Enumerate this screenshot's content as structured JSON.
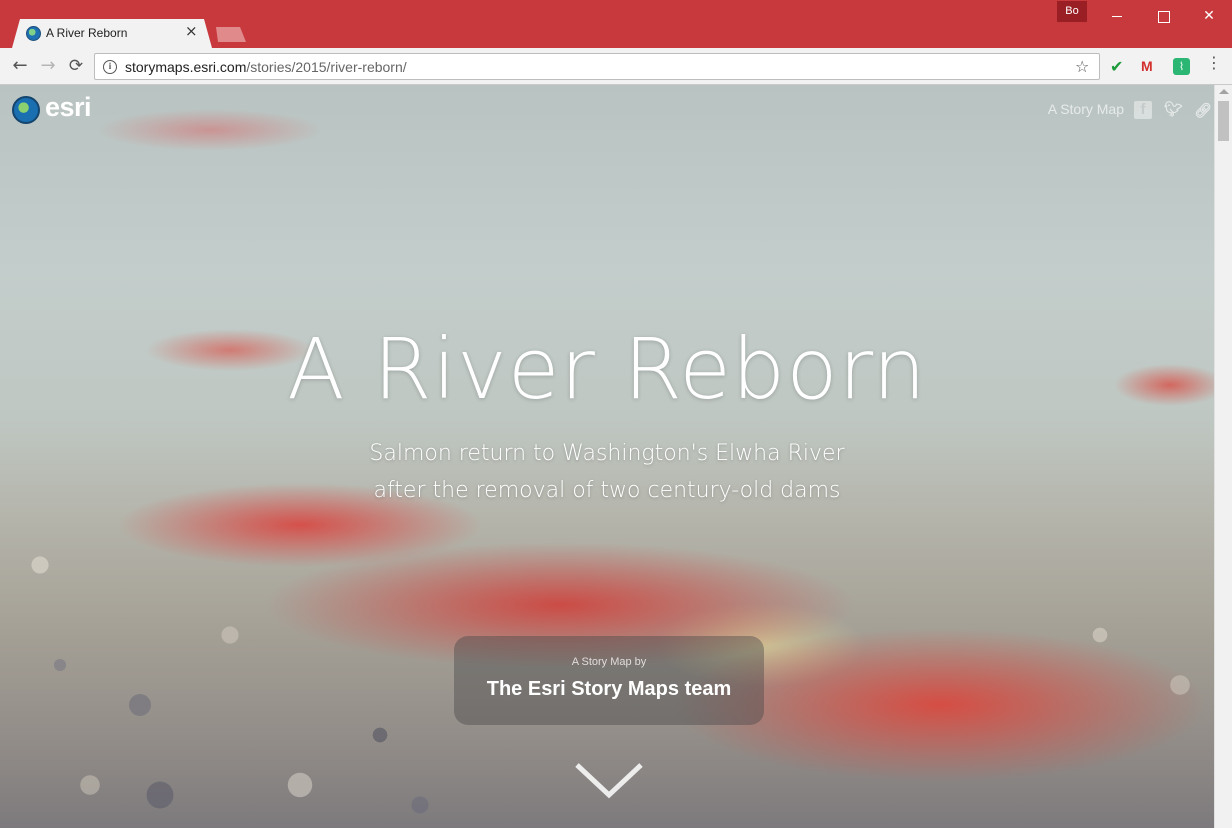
{
  "browser": {
    "tab_title": "A River Reborn",
    "tab_close": "×",
    "profile": "Bo",
    "url_host": "storymaps.esri.com",
    "url_path": "/stories/2015/river-reborn/",
    "accent_color": "#c8393d"
  },
  "header": {
    "logo_text": "esri",
    "story_map_link": "A Story Map",
    "social": [
      "facebook-icon",
      "twitter-icon",
      "link-icon"
    ]
  },
  "hero": {
    "title": "A River Reborn",
    "subtitle_line1": "Salmon return to Washington's Elwha River",
    "subtitle_line2": "after the removal of two century-old dams"
  },
  "byline": {
    "prefix": "A Story Map by",
    "author": "The Esri Story Maps team"
  }
}
